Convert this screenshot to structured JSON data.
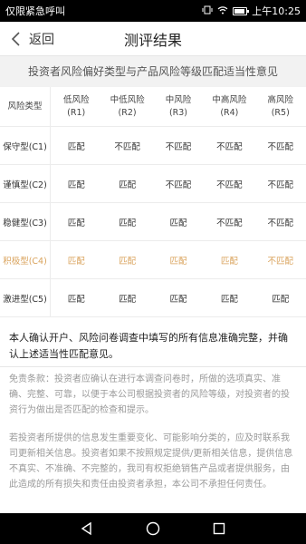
{
  "status_bar": {
    "carrier_text": "仅限紧急呼叫",
    "time": "上午10:25",
    "icons": [
      "vibrate-icon",
      "wifi-icon",
      "battery-icon"
    ]
  },
  "nav": {
    "back_label": "返回",
    "title": "测评结果"
  },
  "subtitle": "投资者风险偏好类型与产品风险等级匹配适当性意见",
  "table": {
    "corner_label": "风险类型",
    "columns": [
      {
        "name": "低风险",
        "code": "(R1)"
      },
      {
        "name": "中低风险",
        "code": "(R2)"
      },
      {
        "name": "中风险",
        "code": "(R3)"
      },
      {
        "name": "中高风险",
        "code": "(R4)"
      },
      {
        "name": "高风险",
        "code": "(R5)"
      }
    ],
    "rows": [
      {
        "type": "保守型(C1)",
        "cells": [
          "匹配",
          "不匹配",
          "不匹配",
          "不匹配",
          "不匹配"
        ],
        "highlight": false
      },
      {
        "type": "谨慎型(C2)",
        "cells": [
          "匹配",
          "匹配",
          "不匹配",
          "不匹配",
          "不匹配"
        ],
        "highlight": false
      },
      {
        "type": "稳健型(C3)",
        "cells": [
          "匹配",
          "匹配",
          "匹配",
          "不匹配",
          "不匹配"
        ],
        "highlight": false
      },
      {
        "type": "积极型(C4)",
        "cells": [
          "匹配",
          "匹配",
          "匹配",
          "匹配",
          "不匹配"
        ],
        "highlight": true
      },
      {
        "type": "激进型(C5)",
        "cells": [
          "匹配",
          "匹配",
          "匹配",
          "匹配",
          "匹配"
        ],
        "highlight": false
      }
    ],
    "highlight_color": "#d9a25b"
  },
  "confirm_text": "本人确认开户、风险问卷调查中填写的所有信息准确完整，并确认上述适当性匹配意见。",
  "disclaimer": [
    "免责条款：投资者应确认在进行本调查问卷时，所做的选项真实、准确、完整、可靠，以便于本公司根据投资者的风险等级，对投资者的投资行为做出是否匹配的检查和提示。",
    "若投资者所提供的信息发生重要变化、可能影响分类的，应及时联系我司更新相关信息。投资者如果不按照规定提供/更新相关信息，提供信息不真实、不准确、不完整的，我司有权拒绝销售产品或者提供服务，由此造成的所有损失和责任由投资者承担，本公司不承担任何责任。"
  ],
  "system_nav": {
    "keys": [
      "back-triangle-icon",
      "home-circle-icon",
      "recents-square-icon"
    ]
  }
}
